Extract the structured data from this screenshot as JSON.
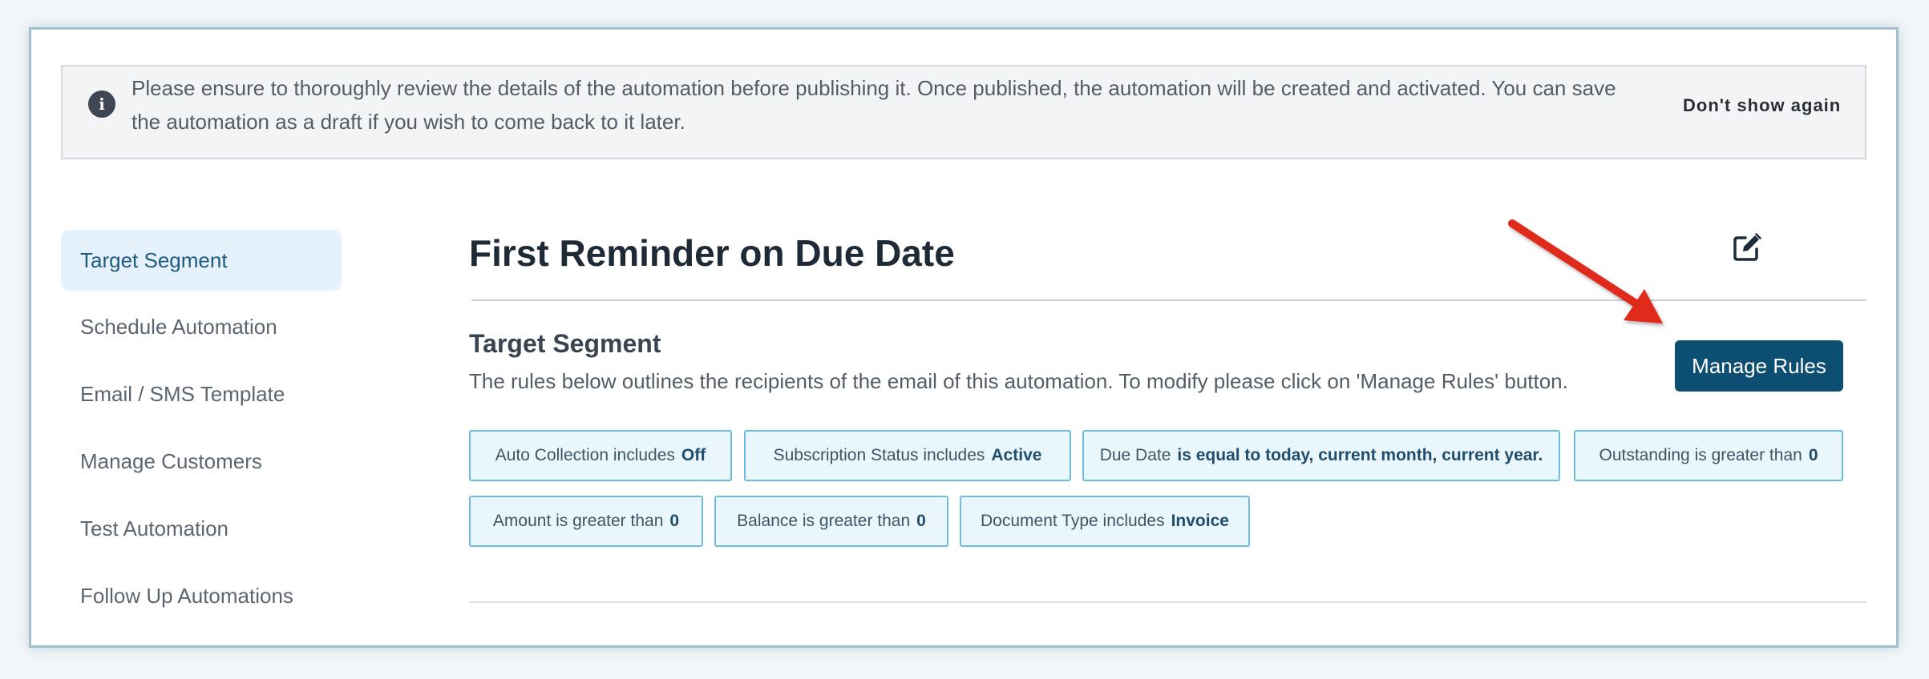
{
  "banner": {
    "message": "Please ensure to thoroughly review the details of the automation before publishing it. Once published, the automation will be created and activated. You can save the automation as a draft if you wish to come back to it later.",
    "dismiss_label": "Don't show again",
    "icon": "info-icon"
  },
  "sidebar": {
    "items": [
      {
        "label": "Target Segment",
        "active": true
      },
      {
        "label": "Schedule Automation"
      },
      {
        "label": "Email / SMS Template"
      },
      {
        "label": "Manage Customers"
      },
      {
        "label": "Test Automation"
      },
      {
        "label": "Follow Up Automations"
      }
    ]
  },
  "main": {
    "title": "First Reminder on Due Date",
    "edit_icon": "edit-icon",
    "section_title": "Target Segment",
    "section_description": "The rules below outlines the recipients of the email of this automation. To modify please click on 'Manage Rules' button.",
    "manage_rules_label": "Manage Rules",
    "rules": [
      {
        "text": "Auto Collection includes",
        "value": "Off"
      },
      {
        "text": "Subscription Status includes",
        "value": "Active"
      },
      {
        "text": "Due Date",
        "value": "is equal to today, current month, current year."
      },
      {
        "text": "Outstanding is greater than",
        "value": "0"
      },
      {
        "text": "Amount is greater than",
        "value": "0"
      },
      {
        "text": "Balance is greater than",
        "value": "0"
      },
      {
        "text": "Document Type includes",
        "value": "Invoice"
      }
    ]
  },
  "colors": {
    "accent": "#0d4e73",
    "annotation_arrow": "#e02a1f",
    "chip_border": "#6dbbe0",
    "active_nav_bg": "#e5f2fb"
  }
}
